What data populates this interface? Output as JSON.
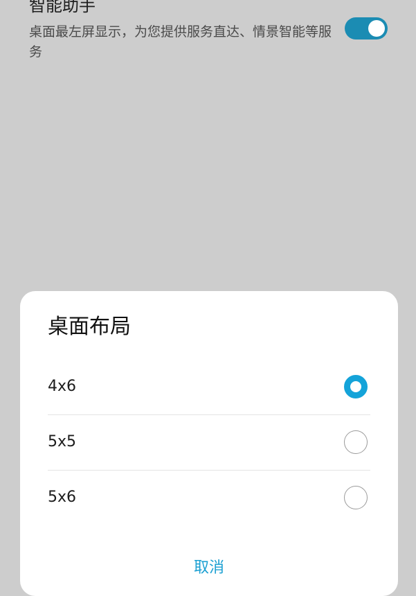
{
  "background_setting": {
    "title": "智能助手",
    "description": "桌面最左屏显示，为您提供服务直达、情景智能等服务",
    "toggle_on": true
  },
  "dialog": {
    "title": "桌面布局",
    "options": [
      {
        "label": "4x6",
        "selected": true
      },
      {
        "label": "5x5",
        "selected": false
      },
      {
        "label": "5x6",
        "selected": false
      }
    ],
    "cancel_label": "取消"
  },
  "colors": {
    "accent": "#14a3d9",
    "toggle": "#1b8cb3",
    "overlay_bg": "#cdcdcd",
    "dialog_bg": "#ffffff"
  }
}
